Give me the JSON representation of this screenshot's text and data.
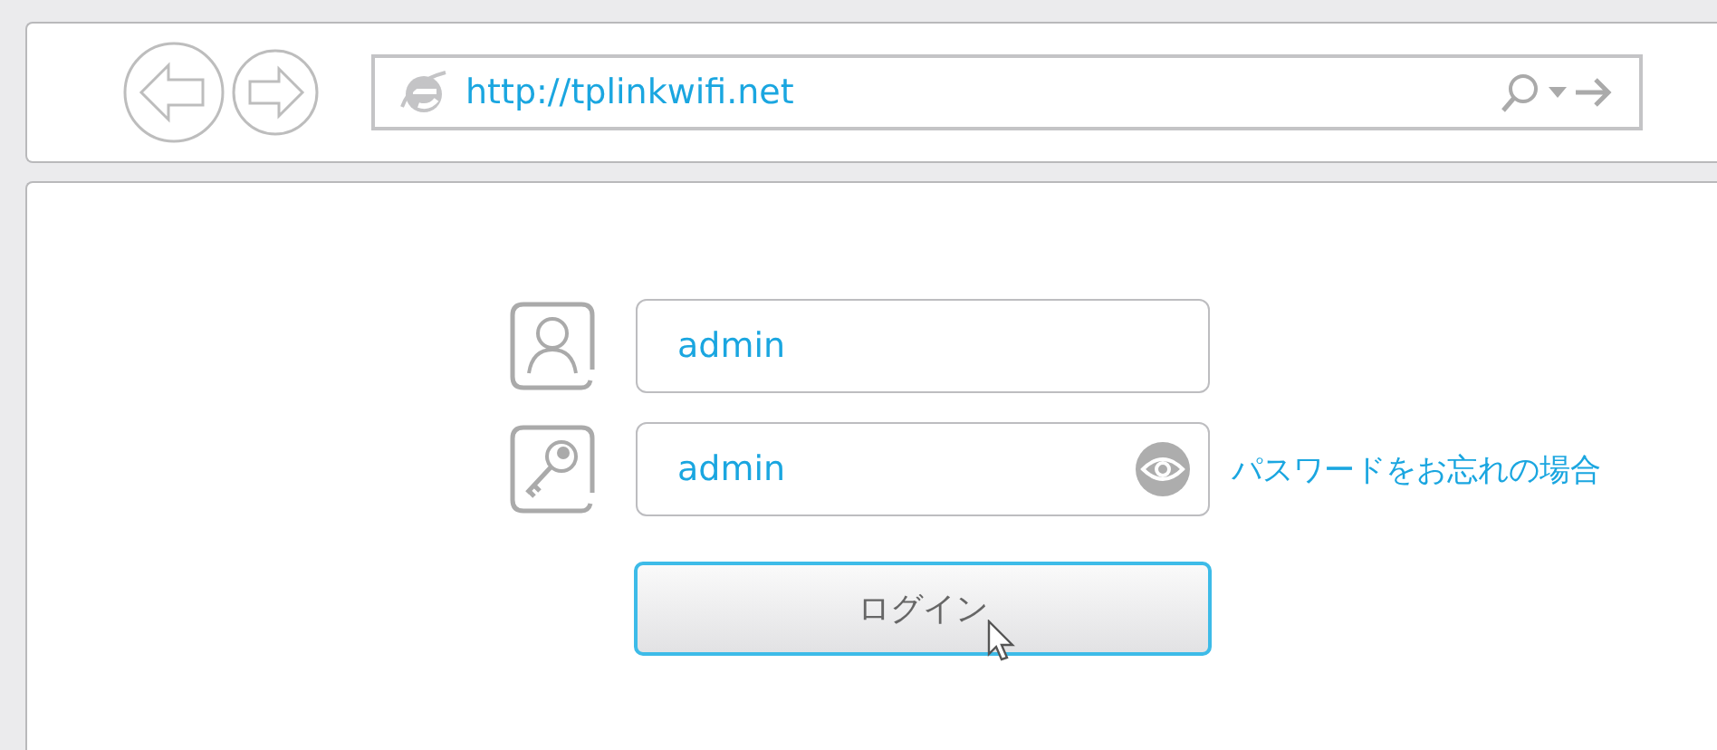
{
  "browser": {
    "url": "http://tplinkwifi.net"
  },
  "login": {
    "username": {
      "value": "admin"
    },
    "password": {
      "value": "admin"
    },
    "forgot_link": "パスワードをお忘れの場合",
    "login_button": "ログイン"
  }
}
